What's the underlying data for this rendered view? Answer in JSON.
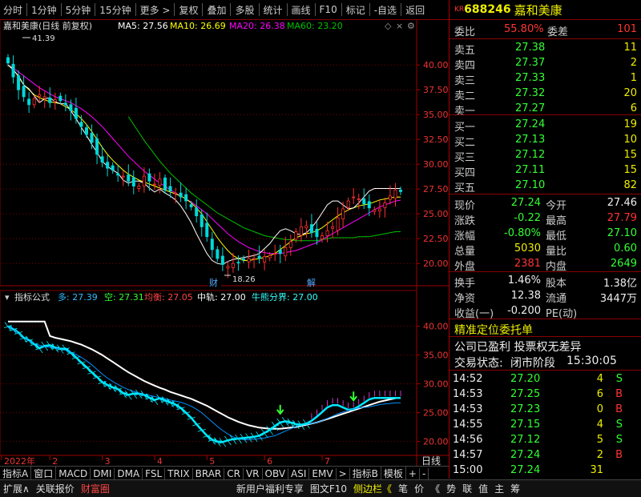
{
  "toolbar": {
    "items": [
      "分时",
      "1分钟",
      "5分钟",
      "15分钟",
      "更多 >",
      "复权",
      "叠加",
      "多股",
      "统计",
      "画线",
      "F10",
      "标记",
      "-自选",
      "返回"
    ]
  },
  "stock": {
    "code_prefix": "KR",
    "code": "688246",
    "name": "嘉和美康"
  },
  "main_legend": {
    "title": "嘉和美康(日线 前复权)",
    "ma5": "MA5: 27.56",
    "ma10": "MA10: 26.69",
    "ma20": "MA20: 26.38",
    "ma60": "MA60: 23.20"
  },
  "annotations": {
    "high": "41.39",
    "low": "18.26",
    "cai": "财",
    "jie": "解"
  },
  "indicator_legend": {
    "name": "指标公式",
    "duo": "多: 27.39",
    "kong": "空: 27.31",
    "junheng": "均衡: 27.05",
    "zhonggui": "中轨: 27.00",
    "niuxiong": "牛熊分界: 27.00"
  },
  "x_axis": {
    "labels": [
      "2022年",
      "2",
      "3",
      "4",
      "5",
      "6",
      "7"
    ],
    "period": "日线"
  },
  "bottom_tabs_1": [
    "指标A",
    "窗口",
    "MACD",
    "DMI",
    "DMA",
    "FSL",
    "TRIX",
    "BRAR",
    "CR",
    "VR",
    "OBV",
    "ASI",
    "EMV",
    ">",
    "指标B",
    "模板",
    "+",
    "-"
  ],
  "bottom_tabs_2": [
    "扩展∧",
    "关联报价",
    "财富圈",
    "新用户福利专享",
    "图文F10",
    "侧边栏《",
    "笔",
    "价",
    "《",
    "势",
    "联",
    "值",
    "主",
    "筹"
  ],
  "quote": {
    "weibi_label": "委比",
    "weibi": "55.80%",
    "weicha_label": "委差",
    "weicha": "101",
    "asks": [
      {
        "label": "卖五",
        "price": "27.38",
        "vol": "11"
      },
      {
        "label": "卖四",
        "price": "27.37",
        "vol": "2"
      },
      {
        "label": "卖三",
        "price": "27.33",
        "vol": "1"
      },
      {
        "label": "卖二",
        "price": "27.32",
        "vol": "20"
      },
      {
        "label": "卖一",
        "price": "27.27",
        "vol": "6"
      }
    ],
    "bids": [
      {
        "label": "买一",
        "price": "27.24",
        "vol": "19"
      },
      {
        "label": "买二",
        "price": "27.13",
        "vol": "10"
      },
      {
        "label": "买三",
        "price": "27.12",
        "vol": "15"
      },
      {
        "label": "买四",
        "price": "27.11",
        "vol": "15"
      },
      {
        "label": "买五",
        "price": "27.10",
        "vol": "82"
      }
    ],
    "stats": [
      {
        "l1": "现价",
        "v1": "27.24",
        "c1": "green",
        "l2": "今开",
        "v2": "27.46",
        "c2": "white"
      },
      {
        "l1": "涨跌",
        "v1": "-0.22",
        "c1": "green",
        "l2": "最高",
        "v2": "27.79",
        "c2": "red"
      },
      {
        "l1": "涨幅",
        "v1": "-0.80%",
        "c1": "green",
        "l2": "最低",
        "v2": "27.10",
        "c2": "green"
      },
      {
        "l1": "总量",
        "v1": "5030",
        "c1": "yellow",
        "l2": "量比",
        "v2": "0.60",
        "c2": "green"
      },
      {
        "l1": "外盘",
        "v1": "2381",
        "c1": "red",
        "l2": "内盘",
        "v2": "2649",
        "c2": "green"
      }
    ],
    "stats2": [
      {
        "l1": "换手",
        "v1": "1.46%",
        "l2": "股本",
        "v2": "1.38亿"
      },
      {
        "l1": "净资",
        "v1": "12.38",
        "l2": "流通",
        "v2": "3447万"
      },
      {
        "l1": "收益(一)",
        "v1": "-0.200",
        "l2": "PE(动)",
        "v2": ""
      }
    ],
    "notice_title": "精准定位委托单",
    "notice_line": "公司已盈利 投票权无差异",
    "status_label": "交易状态:",
    "status_value": "闭市阶段",
    "status_time": "15:30:05",
    "ticks": [
      {
        "time": "14:52",
        "price": "27.20",
        "vol": "4",
        "side": "S"
      },
      {
        "time": "14:53",
        "price": "27.25",
        "vol": "6",
        "side": "B"
      },
      {
        "time": "14:53",
        "price": "27.23",
        "vol": "0",
        "side": "B"
      },
      {
        "time": "14:55",
        "price": "27.15",
        "vol": "4",
        "side": "S"
      },
      {
        "time": "14:56",
        "price": "27.12",
        "vol": "5",
        "side": "S"
      },
      {
        "time": "14:57",
        "price": "27.24",
        "vol": "2",
        "side": "B"
      },
      {
        "time": "15:00",
        "price": "27.24",
        "vol": "31",
        "side": ""
      }
    ]
  },
  "colors": {
    "up": "#ff3030",
    "down": "#00d8d8",
    "ma5": "#ffffff",
    "ma10": "#ffff00",
    "ma20": "#ff00ff",
    "ma60": "#00c000",
    "indicator_cyan": "#00e8ff",
    "grid": "#800000"
  },
  "chart_data": {
    "type": "candlestick",
    "title": "嘉和美康(日线 前复权)",
    "price_axis_ticks": [
      40.0,
      37.5,
      35.0,
      32.5,
      30.0,
      27.5,
      25.0,
      22.5,
      20.0
    ],
    "ylim": [
      18.0,
      43.0
    ],
    "indicator_axis_ticks": [
      40.0,
      35.0,
      30.0,
      25.0,
      20.0
    ],
    "indicator_ylim": [
      18.0,
      43.0
    ],
    "months": [
      "2022年",
      "2",
      "3",
      "4",
      "5",
      "6",
      "7"
    ],
    "close_series": [
      40.2,
      38.8,
      37.5,
      36.8,
      36.0,
      36.6,
      37.0,
      36.8,
      36.2,
      36.5,
      36.4,
      36.0,
      35.4,
      34.6,
      33.8,
      33.0,
      32.2,
      31.0,
      30.2,
      29.6,
      29.4,
      28.9,
      28.8,
      28.3,
      27.8,
      27.8,
      28.8,
      28.3,
      28.0,
      28.5,
      27.4,
      27.3,
      27.1,
      26.7,
      26.3,
      25.7,
      24.8,
      23.7,
      22.7,
      21.4,
      20.5,
      19.9,
      19.7,
      20.0,
      20.1,
      20.4,
      20.5,
      20.5,
      20.5,
      20.7,
      20.8,
      21.0,
      21.0,
      21.6,
      22.2,
      23.2,
      23.7,
      23.8,
      23.1,
      22.7,
      22.8,
      23.3,
      23.7,
      24.6,
      25.5,
      26.3,
      26.7,
      26.5,
      26.0,
      25.6,
      25.4,
      25.5,
      26.1,
      26.8,
      27.4,
      27.24
    ],
    "ma5": [
      40.0,
      39.5,
      38.9,
      38.0,
      37.6,
      36.9,
      36.2,
      36.6,
      36.7,
      36.3,
      36.1,
      36.1,
      35.4,
      34.6,
      33.7,
      32.9,
      32.0,
      31.2,
      30.3,
      29.8,
      29.4,
      29.1,
      28.4,
      28.1,
      28.3,
      28.3,
      28.1,
      27.6,
      27.2,
      27.5,
      27.1,
      26.8,
      26.4,
      25.8,
      25.0,
      24.1,
      23.0,
      22.0,
      21.0,
      20.3,
      20.0,
      19.9,
      20.2,
      20.4,
      20.5,
      20.6,
      20.7,
      20.8,
      21.0,
      21.5,
      22.0,
      22.7,
      23.3,
      23.5,
      23.3,
      23.0,
      22.9,
      23.1,
      23.6,
      24.3,
      25.1,
      25.9,
      26.3,
      26.3,
      25.9,
      25.5,
      25.6,
      26.1,
      26.7,
      27.3,
      27.56,
      27.56,
      27.56,
      27.56,
      27.56,
      27.56
    ],
    "ma10": [
      40.0,
      39.6,
      38.8,
      38.0,
      37.5,
      37.0,
      36.7,
      36.5,
      36.3,
      36.2,
      36.1,
      35.8,
      35.5,
      35.1,
      34.6,
      34.0,
      33.3,
      32.5,
      31.7,
      31.0,
      30.4,
      29.9,
      29.4,
      29.0,
      28.7,
      28.4,
      28.2,
      28.0,
      27.8,
      27.6,
      27.4,
      27.2,
      27.0,
      26.8,
      26.5,
      26.1,
      25.6,
      25.0,
      24.2,
      23.4,
      22.6,
      21.9,
      21.3,
      20.8,
      20.5,
      20.3,
      20.3,
      20.4,
      20.5,
      20.6,
      20.8,
      21.0,
      21.4,
      21.8,
      22.2,
      22.6,
      22.8,
      23.0,
      23.1,
      23.3,
      23.6,
      24.0,
      24.4,
      24.8,
      25.1,
      25.4,
      25.6,
      25.8,
      25.9,
      26.0,
      26.2,
      26.4,
      26.5,
      26.6,
      26.7,
      26.69
    ],
    "ma20": [
      40.0,
      39.7,
      39.3,
      38.9,
      38.5,
      38.1,
      37.7,
      37.4,
      37.1,
      36.8,
      36.6,
      36.4,
      36.2,
      35.9,
      35.6,
      35.2,
      34.8,
      34.3,
      33.8,
      33.2,
      32.6,
      32.0,
      31.4,
      30.8,
      30.3,
      29.8,
      29.3,
      28.9,
      28.5,
      28.1,
      27.8,
      27.4,
      27.1,
      26.8,
      26.5,
      26.2,
      25.8,
      25.4,
      25.0,
      24.5,
      24.0,
      23.5,
      23.0,
      22.6,
      22.2,
      21.9,
      21.6,
      21.4,
      21.2,
      21.1,
      21.0,
      21.0,
      21.0,
      21.1,
      21.2,
      21.3,
      21.5,
      21.7,
      21.9,
      22.1,
      22.4,
      22.7,
      23.0,
      23.3,
      23.6,
      23.9,
      24.2,
      24.5,
      24.8,
      25.1,
      25.4,
      25.7,
      25.9,
      26.1,
      26.3,
      26.38
    ],
    "ma60": [
      null,
      null,
      null,
      null,
      null,
      null,
      null,
      null,
      null,
      null,
      null,
      null,
      null,
      null,
      null,
      null,
      null,
      null,
      null,
      null,
      null,
      null,
      null,
      34.8,
      34.0,
      33.2,
      32.4,
      31.7,
      31.0,
      30.3,
      29.7,
      29.1,
      28.6,
      28.1,
      27.6,
      27.1,
      26.7,
      26.3,
      25.9,
      25.5,
      25.1,
      24.8,
      24.5,
      24.2,
      23.9,
      23.6,
      23.4,
      23.2,
      23.0,
      22.8,
      22.7,
      22.6,
      22.5,
      22.4,
      22.4,
      22.3,
      22.3,
      22.3,
      22.3,
      22.3,
      22.4,
      22.5,
      22.6,
      22.6,
      22.6,
      22.6,
      22.6,
      22.7,
      22.7,
      22.7,
      22.8,
      22.9,
      23.0,
      23.1,
      23.2,
      23.2
    ]
  }
}
